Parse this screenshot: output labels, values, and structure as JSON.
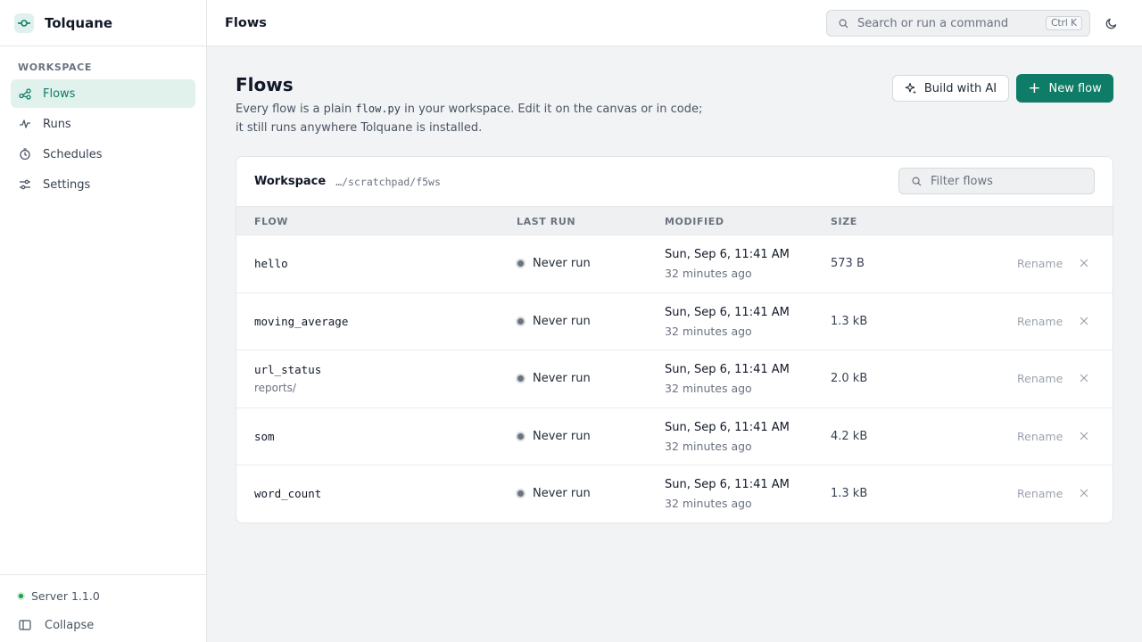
{
  "brand": {
    "name": "Tolquane"
  },
  "sidebar": {
    "heading": "WORKSPACE",
    "items": [
      {
        "label": "Flows",
        "icon": "flows-icon",
        "active": true
      },
      {
        "label": "Runs",
        "icon": "activity-icon",
        "active": false
      },
      {
        "label": "Schedules",
        "icon": "clock-icon",
        "active": false
      },
      {
        "label": "Settings",
        "icon": "sliders-icon",
        "active": false
      }
    ],
    "server": "Server 1.1.0",
    "collapse": "Collapse"
  },
  "topbar": {
    "title": "Flows",
    "search_placeholder": "Search or run a command",
    "shortcut": "Ctrl K"
  },
  "page": {
    "title": "Flows",
    "desc_part1": "Every flow is a plain ",
    "desc_code": "flow.py",
    "desc_part2": " in your workspace. Edit it on the canvas or in code;",
    "desc_line2": "it still runs anywhere Tolquane is installed.",
    "build_ai_label": "Build with AI",
    "new_flow_label": "New flow"
  },
  "workspace": {
    "label": "Workspace",
    "path": "…/scratchpad/f5ws",
    "filter_placeholder": "Filter flows"
  },
  "table": {
    "columns": [
      "FLOW",
      "LAST RUN",
      "MODIFIED",
      "SIZE"
    ],
    "rows": [
      {
        "name": "hello",
        "sub": "",
        "last_run": "Never run",
        "modified": "Sun, Sep 6, 11:41 AM",
        "modified_rel": "32 minutes ago",
        "size": "573 B",
        "rename": "Rename"
      },
      {
        "name": "moving_average",
        "sub": "",
        "last_run": "Never run",
        "modified": "Sun, Sep 6, 11:41 AM",
        "modified_rel": "32 minutes ago",
        "size": "1.3 kB",
        "rename": "Rename"
      },
      {
        "name": "url_status",
        "sub": "reports/",
        "last_run": "Never run",
        "modified": "Sun, Sep 6, 11:41 AM",
        "modified_rel": "32 minutes ago",
        "size": "2.0 kB",
        "rename": "Rename"
      },
      {
        "name": "som",
        "sub": "",
        "last_run": "Never run",
        "modified": "Sun, Sep 6, 11:41 AM",
        "modified_rel": "32 minutes ago",
        "size": "4.2 kB",
        "rename": "Rename"
      },
      {
        "name": "word_count",
        "sub": "",
        "last_run": "Never run",
        "modified": "Sun, Sep 6, 11:41 AM",
        "modified_rel": "32 minutes ago",
        "size": "1.3 kB",
        "rename": "Rename"
      }
    ]
  },
  "colors": {
    "accent": "#0e7c66",
    "accent_soft": "#e1f1ec",
    "server_ok": "#16a34a",
    "status_idle": "#6b7280"
  }
}
